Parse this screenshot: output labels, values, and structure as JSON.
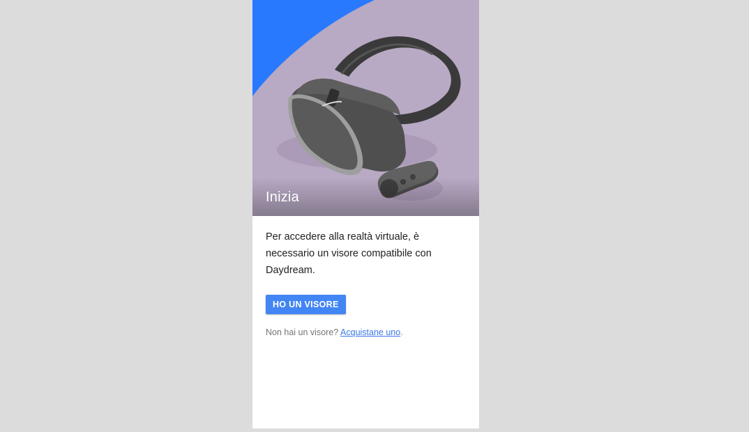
{
  "hero": {
    "title": "Inizia",
    "illustration": "daydream-headset-and-controller"
  },
  "body": {
    "description": "Per accedere alla realtà virtuale, è necessario un visore compatibile con Daydream.",
    "primary_button_label": "HO UN VISORE",
    "no_headset_prefix": "Non hai un visore?",
    "buy_link_label": "Acquistane uno",
    "buy_link_suffix": "."
  },
  "colors": {
    "page_background": "#dcdcdc",
    "hero_background": "#b8a9c4",
    "accent_blue": "#2979ff",
    "button_blue": "#4285f4",
    "link_blue": "#3b78e7"
  }
}
